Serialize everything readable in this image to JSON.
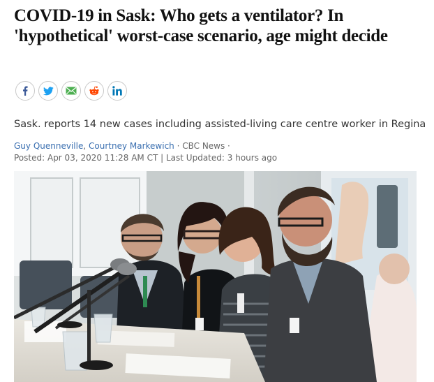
{
  "article": {
    "headline": "COVID-19 in Sask: Who gets a ventilator? In 'hypothetical' worst-case scenario, age might decide",
    "subheadline": "Sask. reports 14 new cases including assisted-living care centre worker in Regina",
    "authors": [
      "Guy Quenneville",
      "Courtney Markewich"
    ],
    "author_separator": ",",
    "source": "· CBC News ·",
    "posted_label": "Posted:",
    "posted_date": "Apr 03, 2020 11:28 AM CT",
    "updated_separator": "|",
    "updated_label": "Last Updated:",
    "updated_value": "3 hours ago"
  },
  "share": [
    {
      "icon": "facebook-icon",
      "color": "#3b5998"
    },
    {
      "icon": "twitter-icon",
      "color": "#1da1f2"
    },
    {
      "icon": "email-icon",
      "color": "#4caf50"
    },
    {
      "icon": "reddit-icon",
      "color": "#ff4500"
    },
    {
      "icon": "linkedin-icon",
      "color": "#0077b5"
    }
  ],
  "colors": {
    "link": "#3a6fb0",
    "meta": "#666666"
  }
}
